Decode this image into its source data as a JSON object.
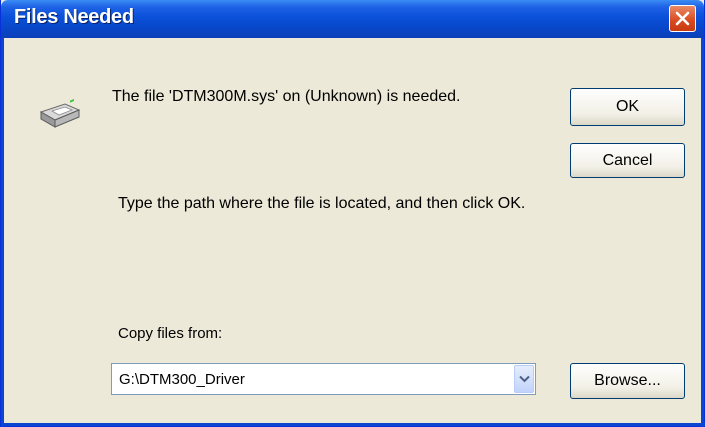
{
  "window": {
    "title": "Files Needed"
  },
  "icons": {
    "close": "close-icon",
    "drive": "drive-icon",
    "dropdown": "chevron-down-icon"
  },
  "message": {
    "needed": "The file 'DTM300M.sys' on (Unknown) is needed.",
    "instruction": "Type the path where the file is located, and then click OK."
  },
  "copy_from": {
    "label": "Copy files from:",
    "value": "G:\\DTM300_Driver"
  },
  "buttons": {
    "ok": "OK",
    "cancel": "Cancel",
    "browse": "Browse..."
  },
  "colors": {
    "titlebar": "#0a50d9",
    "dialog_bg": "#ece9d8",
    "close": "#d9491f"
  }
}
